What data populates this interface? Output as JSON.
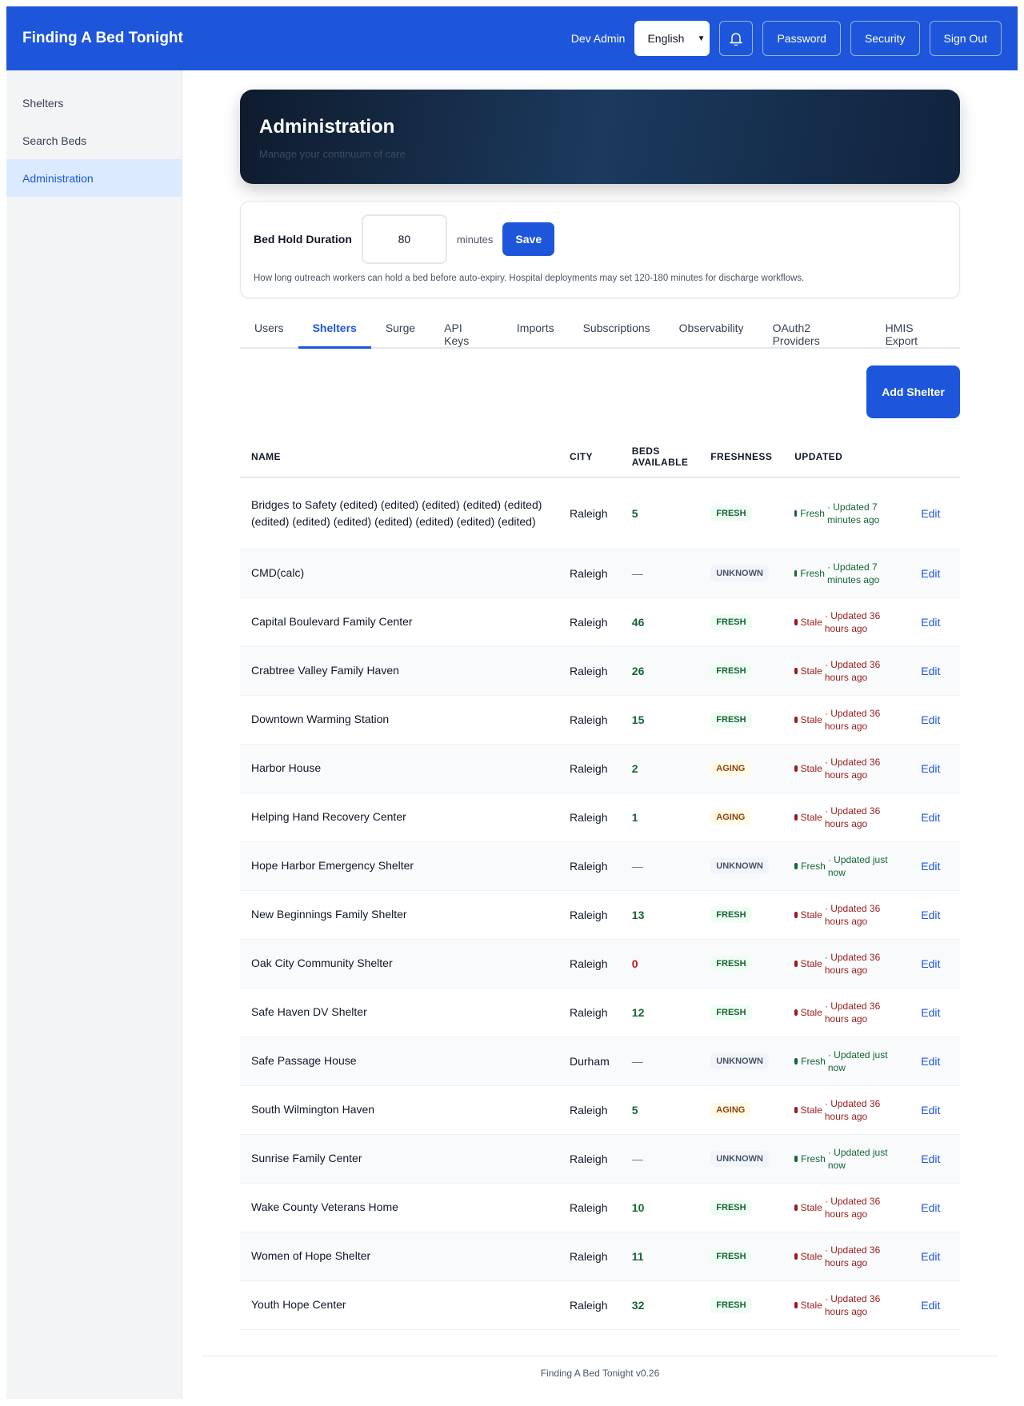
{
  "header": {
    "title": "Finding A Bed Tonight",
    "user": "Dev Admin",
    "language": "English",
    "bell_icon": "bell-icon",
    "buttons": {
      "password": "Password",
      "security": "Security",
      "sign_out": "Sign Out"
    }
  },
  "sidebar": {
    "items": [
      {
        "label": "Shelters"
      },
      {
        "label": "Search Beds"
      },
      {
        "label": "Administration",
        "active": true
      }
    ]
  },
  "hero": {
    "title": "Administration",
    "subtitle": "Manage your continuum of care"
  },
  "bed_hold": {
    "label": "Bed Hold Duration",
    "value": "80",
    "unit": "minutes",
    "save": "Save",
    "help": "How long outreach workers can hold a bed before auto-expiry. Hospital deployments may set 120-180 minutes for discharge workflows."
  },
  "tabs": [
    {
      "label": "Users"
    },
    {
      "label": "Shelters",
      "active": true
    },
    {
      "label": "Surge"
    },
    {
      "label": "API Keys"
    },
    {
      "label": "Imports"
    },
    {
      "label": "Subscriptions"
    },
    {
      "label": "Observability"
    },
    {
      "label": "OAuth2 Providers"
    },
    {
      "label": "HMIS Export"
    }
  ],
  "add_shelter": "Add Shelter",
  "table": {
    "columns": [
      "NAME",
      "CITY",
      "BEDS AVAILABLE",
      "FRESHNESS",
      "UPDATED",
      ""
    ],
    "edit_label": "Edit",
    "rows": [
      {
        "name": "Bridges to Safety (edited) (edited) (edited) (edited) (edited) (edited) (edited) (edited) (edited) (edited) (edited) (edited)",
        "city": "Raleigh",
        "beds": "5",
        "freshness": "FRESH",
        "status": "Fresh",
        "updated": "· Updated 7 minutes ago"
      },
      {
        "name": "CMD(calc)",
        "city": "Raleigh",
        "beds": "—",
        "freshness": "UNKNOWN",
        "status": "Fresh",
        "updated": "· Updated 7 minutes ago"
      },
      {
        "name": "Capital Boulevard Family Center",
        "city": "Raleigh",
        "beds": "46",
        "freshness": "FRESH",
        "status": "Stale",
        "updated": "· Updated 36 hours ago"
      },
      {
        "name": "Crabtree Valley Family Haven",
        "city": "Raleigh",
        "beds": "26",
        "freshness": "FRESH",
        "status": "Stale",
        "updated": "· Updated 36 hours ago"
      },
      {
        "name": "Downtown Warming Station",
        "city": "Raleigh",
        "beds": "15",
        "freshness": "FRESH",
        "status": "Stale",
        "updated": "· Updated 36 hours ago"
      },
      {
        "name": "Harbor House",
        "city": "Raleigh",
        "beds": "2",
        "freshness": "AGING",
        "status": "Stale",
        "updated": "· Updated 36 hours ago"
      },
      {
        "name": "Helping Hand Recovery Center",
        "city": "Raleigh",
        "beds": "1",
        "freshness": "AGING",
        "status": "Stale",
        "updated": "· Updated 36 hours ago"
      },
      {
        "name": "Hope Harbor Emergency Shelter",
        "city": "Raleigh",
        "beds": "—",
        "freshness": "UNKNOWN",
        "status": "Fresh",
        "updated": "· Updated just now"
      },
      {
        "name": "New Beginnings Family Shelter",
        "city": "Raleigh",
        "beds": "13",
        "freshness": "FRESH",
        "status": "Stale",
        "updated": "· Updated 36 hours ago"
      },
      {
        "name": "Oak City Community Shelter",
        "city": "Raleigh",
        "beds": "0",
        "freshness": "FRESH",
        "status": "Stale",
        "updated": "· Updated 36 hours ago"
      },
      {
        "name": "Safe Haven DV Shelter",
        "city": "Raleigh",
        "beds": "12",
        "freshness": "FRESH",
        "status": "Stale",
        "updated": "· Updated 36 hours ago"
      },
      {
        "name": "Safe Passage House",
        "city": "Durham",
        "beds": "—",
        "freshness": "UNKNOWN",
        "status": "Fresh",
        "updated": "· Updated just now"
      },
      {
        "name": "South Wilmington Haven",
        "city": "Raleigh",
        "beds": "5",
        "freshness": "AGING",
        "status": "Stale",
        "updated": "· Updated 36 hours ago"
      },
      {
        "name": "Sunrise Family Center",
        "city": "Raleigh",
        "beds": "—",
        "freshness": "UNKNOWN",
        "status": "Fresh",
        "updated": "· Updated just now"
      },
      {
        "name": "Wake County Veterans Home",
        "city": "Raleigh",
        "beds": "10",
        "freshness": "FRESH",
        "status": "Stale",
        "updated": "· Updated 36 hours ago"
      },
      {
        "name": "Women of Hope Shelter",
        "city": "Raleigh",
        "beds": "11",
        "freshness": "FRESH",
        "status": "Stale",
        "updated": "· Updated 36 hours ago"
      },
      {
        "name": "Youth Hope Center",
        "city": "Raleigh",
        "beds": "32",
        "freshness": "FRESH",
        "status": "Stale",
        "updated": "· Updated 36 hours ago"
      }
    ]
  },
  "footer": "Finding A Bed Tonight v0.26",
  "colors": {
    "brand": "#1d56db",
    "fresh": "#166534",
    "stale": "#991b1b"
  }
}
